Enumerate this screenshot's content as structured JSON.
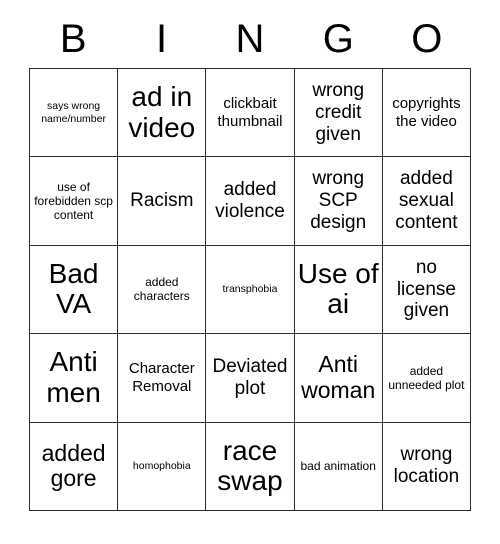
{
  "card": {
    "header_letters": [
      "B",
      "I",
      "N",
      "G",
      "O"
    ],
    "columns": 5,
    "rows": 5,
    "border_color": "#2b2b2b",
    "background_color": "#ffffff",
    "text_color": "#000000",
    "cells": [
      {
        "text": "says wrong name/number",
        "size": "xs"
      },
      {
        "text": "ad in video",
        "size": "xxl"
      },
      {
        "text": "clickbait thumbnail",
        "size": "md"
      },
      {
        "text": "wrong credit given",
        "size": "lg"
      },
      {
        "text": "copyrights the video",
        "size": "md"
      },
      {
        "text": "use of forebidden scp content",
        "size": "sm"
      },
      {
        "text": "Racism",
        "size": "lg"
      },
      {
        "text": "added violence",
        "size": "lg"
      },
      {
        "text": "wrong SCP design",
        "size": "lg"
      },
      {
        "text": "added sexual content",
        "size": "lg"
      },
      {
        "text": "Bad VA",
        "size": "xxl"
      },
      {
        "text": "added characters",
        "size": "sm"
      },
      {
        "text": "transphobia",
        "size": "xs"
      },
      {
        "text": "Use of ai",
        "size": "xxl"
      },
      {
        "text": "no license given",
        "size": "lg"
      },
      {
        "text": "Anti men",
        "size": "xxl"
      },
      {
        "text": "Character Removal",
        "size": "md"
      },
      {
        "text": "Deviated plot",
        "size": "lg"
      },
      {
        "text": "Anti woman",
        "size": "xl"
      },
      {
        "text": "added unneeded plot",
        "size": "sm"
      },
      {
        "text": "added gore",
        "size": "xl"
      },
      {
        "text": "homophobia",
        "size": "xs"
      },
      {
        "text": "race swap",
        "size": "xxl"
      },
      {
        "text": "bad animation",
        "size": "sm"
      },
      {
        "text": "wrong location",
        "size": "lg"
      }
    ]
  }
}
